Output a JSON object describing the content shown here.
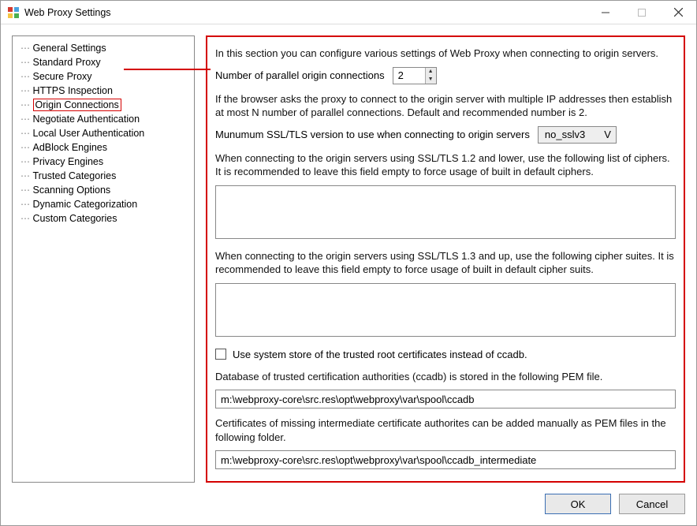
{
  "window": {
    "title": "Web Proxy Settings"
  },
  "tree": {
    "items": [
      {
        "label": "General Settings"
      },
      {
        "label": "Standard Proxy"
      },
      {
        "label": "Secure Proxy"
      },
      {
        "label": "HTTPS Inspection"
      },
      {
        "label": "Origin Connections",
        "selected": true
      },
      {
        "label": "Negotiate Authentication"
      },
      {
        "label": "Local User Authentication"
      },
      {
        "label": "AdBlock Engines"
      },
      {
        "label": "Privacy Engines"
      },
      {
        "label": "Trusted Categories"
      },
      {
        "label": "Scanning Options"
      },
      {
        "label": "Dynamic Categorization"
      },
      {
        "label": "Custom Categories"
      }
    ]
  },
  "panel": {
    "intro": "In this section you can configure various settings of Web Proxy when connecting to origin servers.",
    "parallel_label": "Number of parallel origin connections",
    "parallel_value": "2",
    "parallel_help": "If the browser asks the proxy to connect to the origin server with multiple IP addresses then establish at most N number of parallel connections. Default and recommended number is 2.",
    "min_ssl_label": "Munumum SSL/TLS version to use when connecting to origin servers",
    "min_ssl_value": "no_sslv3",
    "ciphers12_label": "When connecting to the origin servers using SSL/TLS 1.2 and lower, use the following list of ciphers. It is recommended to leave this field empty to force usage of built in default ciphers.",
    "ciphers12_value": "",
    "ciphers13_label": "When connecting to the origin servers using SSL/TLS 1.3 and up, use the following cipher suites. It is recommended to leave this field empty to force usage of built in default cipher suits.",
    "ciphers13_value": "",
    "use_system_store_label": "Use system store of the trusted root certificates instead of ccadb.",
    "use_system_store_checked": false,
    "ccadb_label": "Database of trusted certification authorities (ccadb) is stored in the following PEM file.",
    "ccadb_path": "m:\\webproxy-core\\src.res\\opt\\webproxy\\var\\spool\\ccadb",
    "intermediate_label": "Certificates of missing intermediate certificate authorites can be added manually as PEM files in the following folder.",
    "intermediate_path": "m:\\webproxy-core\\src.res\\opt\\webproxy\\var\\spool\\ccadb_intermediate"
  },
  "buttons": {
    "ok": "OK",
    "cancel": "Cancel"
  }
}
